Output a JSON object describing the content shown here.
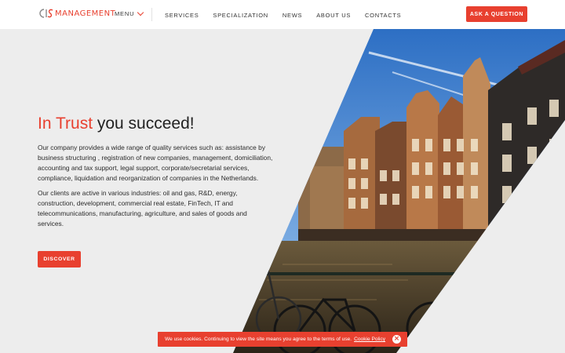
{
  "header": {
    "logo_mark": "CIS",
    "logo_text": "MANAGEMENT",
    "menu_label": "MENU",
    "nav": [
      "SERVICES",
      "SPECIALIZATION",
      "NEWS",
      "ABOUT US",
      "CONTACTS"
    ],
    "cta": "ASK A QUESTION"
  },
  "hero": {
    "headline_accent": "In Trust",
    "headline_rest": " you succeed!",
    "paragraph1": "Our company provides a wide range of quality services such as: assistance by business structuring , registration of new companies, management, domiciliation, accounting and tax support, legal support, corporate/secretarial services, compliance, liquidation and reorganization of companies in the Netherlands.",
    "paragraph2": "Our clients are active in  various industries: oil and gas, R&D, energy, construction, development, commercial real estate, FinTech, IT and telecommunications, manufacturing, agriculture, and sales of goods and services.",
    "button": "DISCOVER",
    "image": "amsterdam-canal-houses-with-bicycles"
  },
  "cookie": {
    "text": "We use cookies. Continuing to view the site means you agree to the terms of use.",
    "link": "Cookie Policy"
  },
  "colors": {
    "accent": "#e8402f",
    "background": "#ededed",
    "header": "#ffffff"
  }
}
